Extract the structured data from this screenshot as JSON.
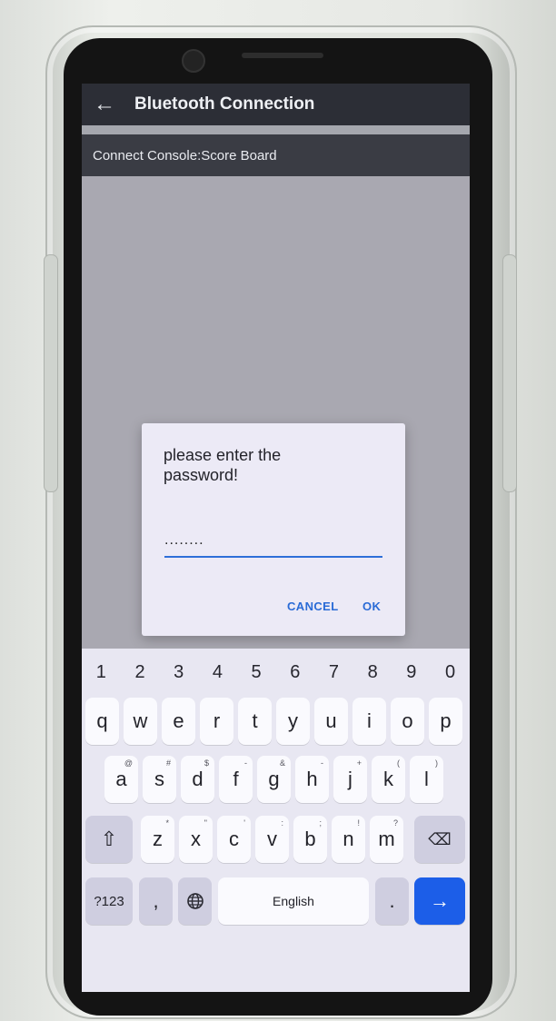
{
  "app_bar": {
    "back_icon": "arrow-left-icon",
    "title": "Bluetooth Connection"
  },
  "status": {
    "text": "Connect Console:Score Board"
  },
  "dialog": {
    "title": "please enter the password!",
    "password_value": "........",
    "cancel_label": "CANCEL",
    "ok_label": "OK",
    "accent_color": "#2a6bd6"
  },
  "keyboard": {
    "numbers": [
      "1",
      "2",
      "3",
      "4",
      "5",
      "6",
      "7",
      "8",
      "9",
      "0"
    ],
    "row1": [
      "q",
      "w",
      "e",
      "r",
      "t",
      "y",
      "u",
      "i",
      "o",
      "p"
    ],
    "row2": [
      {
        "k": "a",
        "h": "@"
      },
      {
        "k": "s",
        "h": "#"
      },
      {
        "k": "d",
        "h": "$"
      },
      {
        "k": "f",
        "h": "-"
      },
      {
        "k": "g",
        "h": "&"
      },
      {
        "k": "h",
        "h": "-"
      },
      {
        "k": "j",
        "h": "+"
      },
      {
        "k": "k",
        "h": "("
      },
      {
        "k": "l",
        "h": ")"
      }
    ],
    "row3": [
      {
        "k": "z",
        "h": "*"
      },
      {
        "k": "x",
        "h": "\""
      },
      {
        "k": "c",
        "h": "'"
      },
      {
        "k": "v",
        "h": ":"
      },
      {
        "k": "b",
        "h": ";"
      },
      {
        "k": "n",
        "h": "!"
      },
      {
        "k": "m",
        "h": "?"
      }
    ],
    "shift_icon": "shift-icon",
    "backspace_icon": "backspace-icon",
    "symbols_label": "?123",
    "comma_label": ",",
    "globe_icon": "globe-icon",
    "space_label": "English",
    "period_label": ".",
    "enter_icon": "arrow-right-icon",
    "enter_color": "#1c5ee8"
  }
}
